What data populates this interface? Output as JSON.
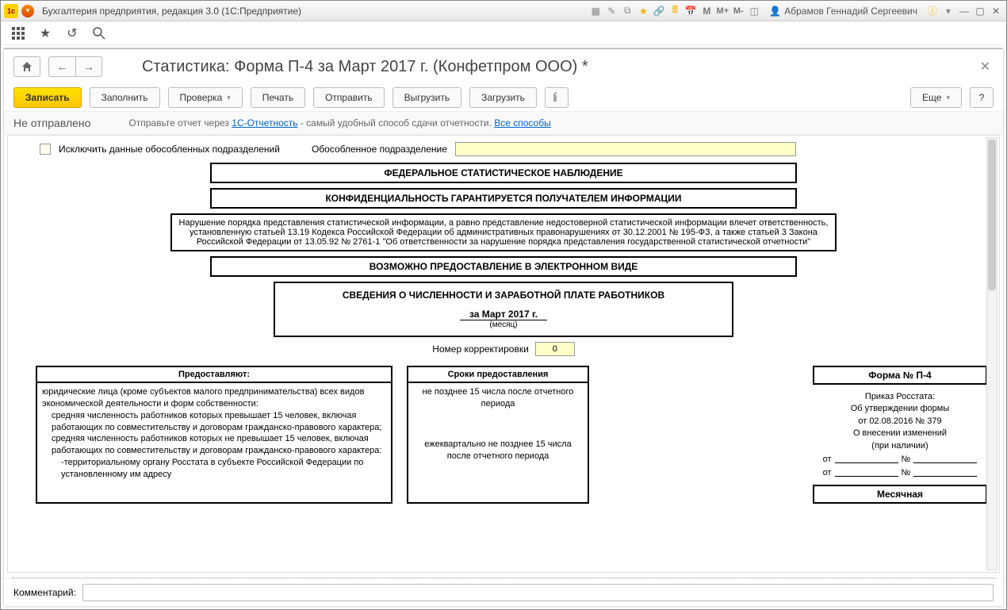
{
  "titlebar": {
    "app_title": "Бухгалтерия предприятия, редакция 3.0  (1С:Предприятие)",
    "user_name": "Абрамов Геннадий Сергеевич",
    "m": "M",
    "m_plus": "M+",
    "m_minus": "M-"
  },
  "page": {
    "title": "Статистика: Форма П-4 за Март 2017 г. (Конфетпром ООО) *"
  },
  "toolbar": {
    "write": "Записать",
    "fill": "Заполнить",
    "check": "Проверка",
    "print": "Печать",
    "send": "Отправить",
    "upload": "Выгрузить",
    "download": "Загрузить",
    "more": "Еще",
    "help": "?"
  },
  "status": {
    "state": "Не отправлено",
    "hint_prefix": "Отправьте отчет через ",
    "link1": "1С-Отчетность",
    "hint_mid": " - самый удобный способ сдачи отчетности. ",
    "link2": "Все способы"
  },
  "doc": {
    "exclude_label": "Исключить данные обособленных подразделений",
    "subdiv_label": "Обособленное подразделение",
    "box1": "ФЕДЕРАЛЬНОЕ СТАТИСТИЧЕСКОЕ НАБЛЮДЕНИЕ",
    "box2": "КОНФИДЕНЦИАЛЬНОСТЬ ГАРАНТИРУЕТСЯ ПОЛУЧАТЕЛЕМ ИНФОРМАЦИИ",
    "box3": "Нарушение порядка представления статистической информации, а равно представление недостоверной статистической информации влечет ответственность, установленную статьей 13.19 Кодекса Российской Федерации об административных правонарушениях от 30.12.2001 № 195-ФЗ, а также статьей 3 Закона Российской Федерации от 13.05.92 № 2761-1 \"Об ответственности за нарушение порядка представления государственной статистической отчетности\"",
    "box4": "ВОЗМОЖНО ПРЕДОСТАВЛЕНИЕ В ЭЛЕКТРОННОМ ВИДЕ",
    "box5_title": "СВЕДЕНИЯ О ЧИСЛЕННОСТИ И ЗАРАБОТНОЙ ПЛАТЕ РАБОТНИКОВ",
    "period": "за Март 2017 г.",
    "month_lbl": "(месяц)",
    "corr_label": "Номер корректировки",
    "corr_value": "0",
    "col1_header": "Предоставляют:",
    "col2_header": "Сроки предоставления",
    "col1_body1": "юридические лица (кроме субъектов малого предпринимательства) всех видов экономической деятельности и форм собственности:",
    "col1_body2": "средняя численность работников которых превышает 15 человек, включая работающих по совместительству и договорам гражданско-правового характера;",
    "col1_body3": "средняя численность работников которых не превышает 15 человек, включая работающих по совместительству и договорам гражданско-правового характера:",
    "col1_body4": "-территориальному органу Росстата в субъекте Российской Федерации по установленному им адресу",
    "col2_body1": "не позднее 15 числа после отчетного периода",
    "col2_body2": "ежеквартально не позднее 15 числа после отчетного периода",
    "form_no": "Форма № П-4",
    "order1": "Приказ Росстата:",
    "order2": "Об утверждении формы",
    "order3": "от 02.08.2016 № 379",
    "order4": "О внесении изменений",
    "order5": "(при наличии)",
    "ot": "от",
    "no": "№",
    "monthly": "Месячная"
  },
  "footer": {
    "comment_label": "Комментарий:"
  }
}
